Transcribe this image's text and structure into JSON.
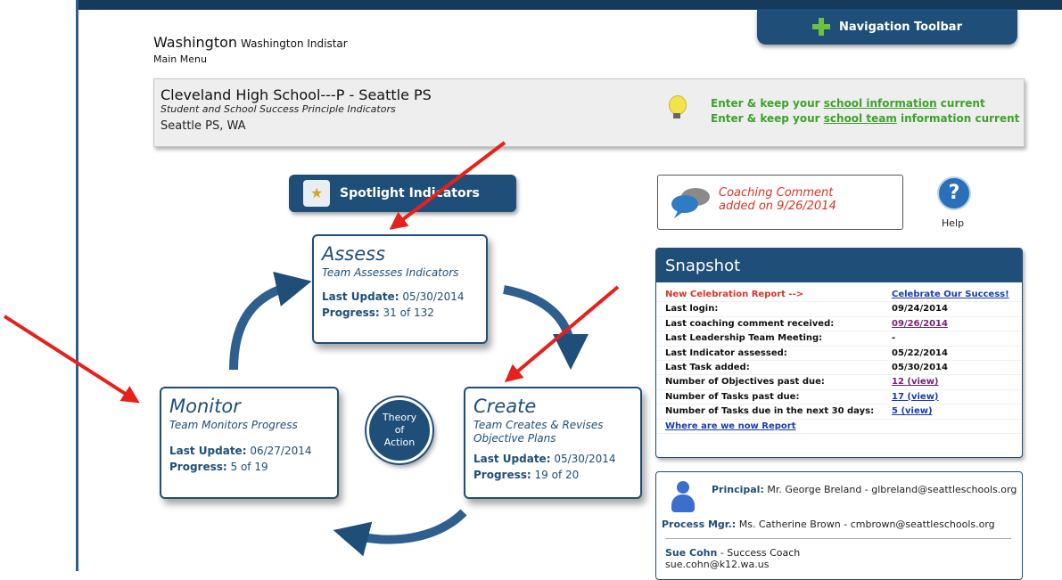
{
  "header": {
    "state_title": "Washington",
    "org_name": "Washington Indistar",
    "main_menu": "Main Menu",
    "nav_toolbar": "Navigation Toolbar"
  },
  "school": {
    "name": "Cleveland High School---P - Seattle PS",
    "subtitle": "Student and School Success Principle Indicators",
    "location": "Seattle PS, WA",
    "line1_prefix": "Enter & keep your ",
    "line1_link": "school information",
    "line1_suffix": " current",
    "line2_prefix": "Enter & keep your ",
    "line2_link": "school team",
    "line2_suffix": " information current"
  },
  "spotlight_label": "Spotlight Indicators",
  "cards": {
    "assess": {
      "title": "Assess",
      "subtitle": "Team Assesses Indicators",
      "update_label": "Last Update:",
      "update_value": "05/30/2014",
      "progress_label": "Progress:",
      "progress_value": "31 of 132"
    },
    "monitor": {
      "title": "Monitor",
      "subtitle": "Team Monitors Progress",
      "update_label": "Last Update:",
      "update_value": "06/27/2014",
      "progress_label": "Progress:",
      "progress_value": "5 of 19"
    },
    "create": {
      "title": "Create",
      "subtitle": "Team Creates & Revises Objective Plans",
      "update_label": "Last Update:",
      "update_value": "05/30/2014",
      "progress_label": "Progress:",
      "progress_value": "19 of 20"
    }
  },
  "theory": {
    "line1": "Theory",
    "line2": "of",
    "line3": "Action"
  },
  "coaching": {
    "line1": "Coaching Comment",
    "line2": "added on 9/26/2014"
  },
  "help_label": "Help",
  "snapshot": {
    "title": "Snapshot",
    "rows": [
      {
        "key": "New Celebration Report -->",
        "value": "Celebrate Our Success!"
      },
      {
        "key": "Last login:",
        "value": "09/24/2014"
      },
      {
        "key": "Last coaching comment received:",
        "value": "09/26/2014"
      },
      {
        "key": "Last Leadership Team Meeting:",
        "value": "-"
      },
      {
        "key": "Last Indicator assessed:",
        "value": "05/22/2014"
      },
      {
        "key": "Last Task added:",
        "value": "05/30/2014"
      },
      {
        "key": "Number of Objectives past due:",
        "value": "12 (view)"
      },
      {
        "key": "Number of Tasks past due:",
        "value": "17 (view)"
      },
      {
        "key": "Number of Tasks due in the next 30 days:",
        "value": "5 (view)"
      },
      {
        "key": "Where are we now Report",
        "value": ""
      }
    ]
  },
  "contacts": {
    "principal_label": "Principal:",
    "principal_value": "Mr. George Breland - glbreland@seattleschools.org",
    "process_label": "Process Mgr.:",
    "process_value": "Ms. Catherine Brown - cmbrown@seattleschools.org",
    "coach_name": "Sue Cohn",
    "coach_role": " - Success Coach",
    "coach_email": "sue.cohn@k12.wa.us"
  },
  "colors": {
    "navy": "#1f4e79",
    "green": "#3ea22b",
    "red": "#d9352a",
    "arrow_red": "#e8201c"
  }
}
